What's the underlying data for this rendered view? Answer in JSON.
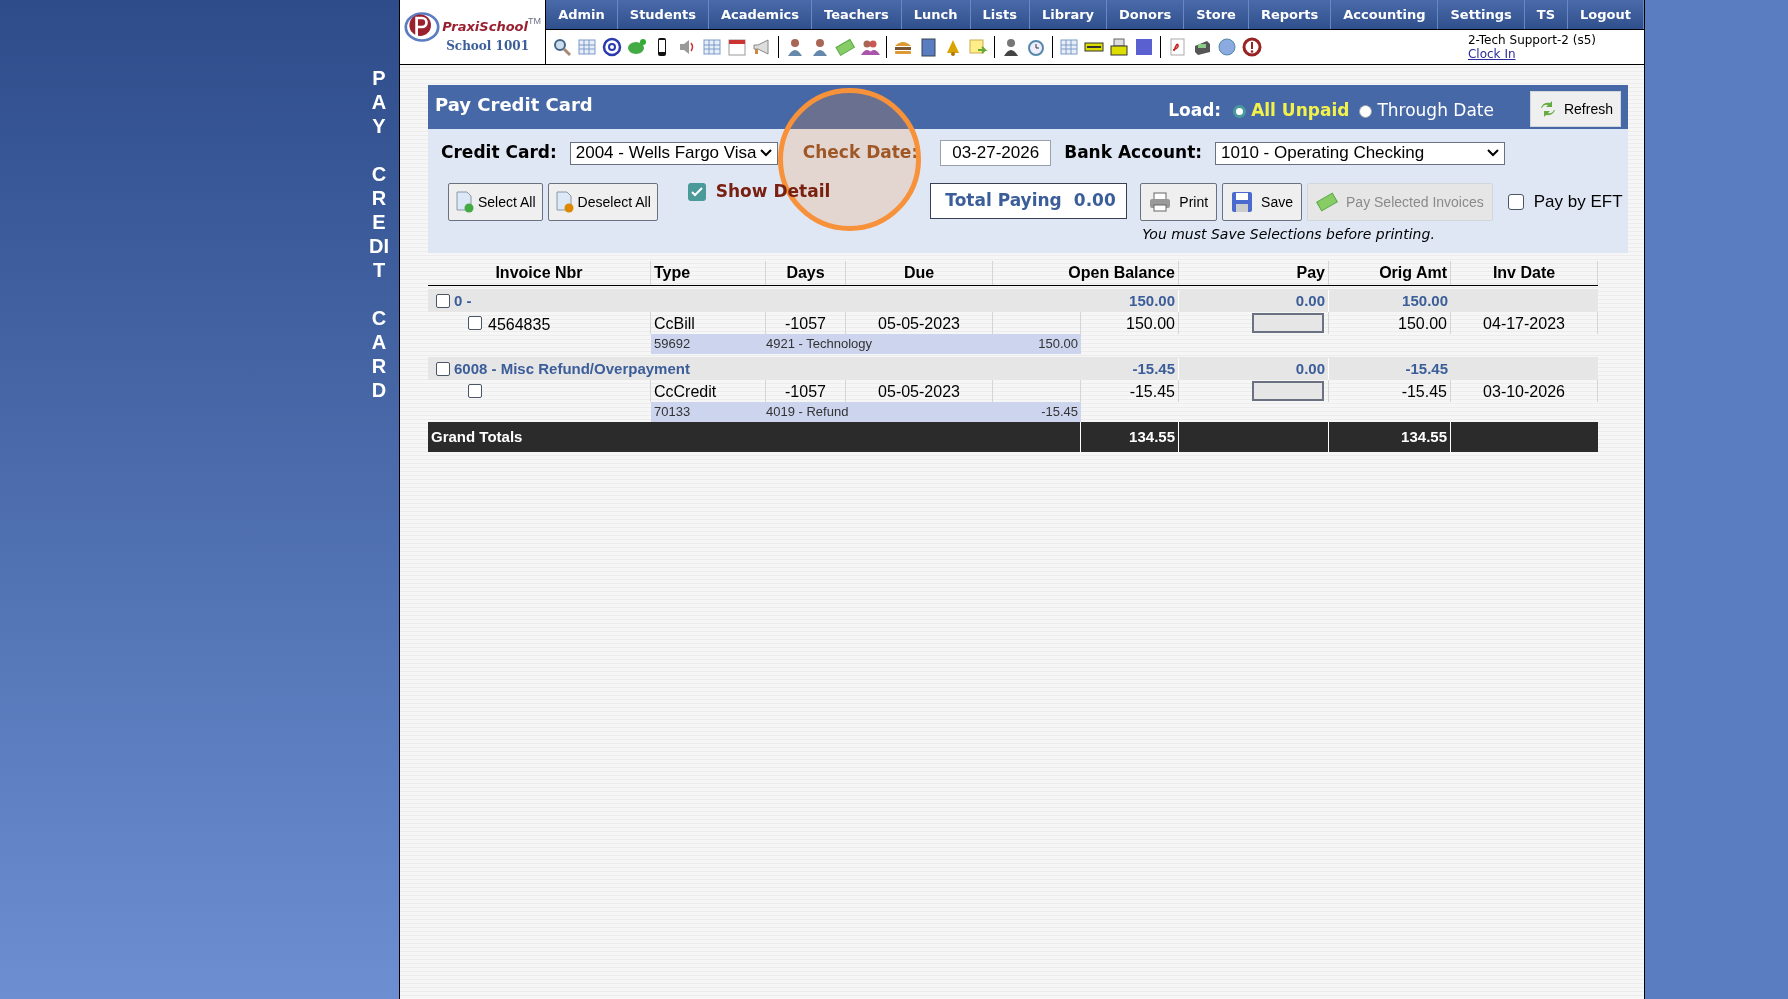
{
  "sidebar": {
    "vertical_title": "PAY CREDIT CARD"
  },
  "header": {
    "logo": {
      "brand": "PraxiSchool",
      "trademark": "TM",
      "school": "School 1001"
    },
    "nav": [
      "Admin",
      "Students",
      "Academics",
      "Teachers",
      "Lunch",
      "Lists",
      "Library",
      "Donors",
      "Store",
      "Reports",
      "Accounting",
      "Settings",
      "TS",
      "Logout"
    ],
    "user": "2-Tech Support-2 (s5)",
    "clock_link": "Clock In"
  },
  "panel": {
    "title": "Pay Credit Card",
    "load_label": "Load:",
    "load_options": [
      {
        "label": "All Unpaid",
        "selected": true
      },
      {
        "label": "Through Date",
        "selected": false
      }
    ],
    "refresh": "Refresh",
    "credit_card": {
      "label": "Credit Card:",
      "value": "2004 - Wells Fargo Visa"
    },
    "check_date": {
      "label": "Check Date:",
      "value": "03-27-2026"
    },
    "bank_account": {
      "label": "Bank Account:",
      "value": "1010 - Operating Checking"
    },
    "select_buttons": [
      {
        "label": "Select All",
        "kind": "add"
      },
      {
        "label": "Deselect All",
        "kind": "remove"
      }
    ],
    "show_detail": {
      "label": "Show Detail",
      "checked": true
    },
    "total_paying": {
      "label": "Total Paying",
      "value": "0.00"
    },
    "actions": [
      {
        "label": "Print",
        "kind": "print",
        "disabled": false
      },
      {
        "label": "Save",
        "kind": "save",
        "disabled": false
      },
      {
        "label": "Pay Selected Invoices",
        "kind": "pay",
        "disabled": true
      }
    ],
    "pay_by_eft": {
      "label": "Pay by EFT",
      "checked": false
    },
    "note": "You must Save Selections before printing."
  },
  "table": {
    "columns": [
      "Invoice Nbr",
      "Type",
      "Days",
      "Due",
      "Open Balance",
      "Pay",
      "Orig Amt",
      "Inv Date"
    ],
    "groups": [
      {
        "label": "0 -",
        "checked": false,
        "open_balance": "150.00",
        "pay": "0.00",
        "orig_amt": "150.00",
        "invoices": [
          {
            "checked": false,
            "invoice_nbr": "4564835",
            "type": "CcBill",
            "days": "-1057",
            "due": "05-05-2023",
            "open_balance": "150.00",
            "orig_amt": "150.00",
            "inv_date": "04-17-2023",
            "detail": {
              "ref": "59692",
              "account": "4921 - Technology",
              "amount": "150.00"
            }
          }
        ]
      },
      {
        "label": "6008 - Misc Refund/Overpayment",
        "checked": false,
        "open_balance": "-15.45",
        "pay": "0.00",
        "orig_amt": "-15.45",
        "invoices": [
          {
            "checked": false,
            "type": "CcCredit",
            "days": "-1057",
            "due": "05-05-2023",
            "open_balance": "-15.45",
            "orig_amt": "-15.45",
            "inv_date": "03-10-2026",
            "detail": {
              "ref": "70133",
              "account": "4019 - Refund",
              "amount": "-15.45"
            }
          }
        ]
      }
    ],
    "grand_totals": {
      "label": "Grand Totals",
      "open_balance": "134.55",
      "orig_amt": "134.55"
    }
  }
}
